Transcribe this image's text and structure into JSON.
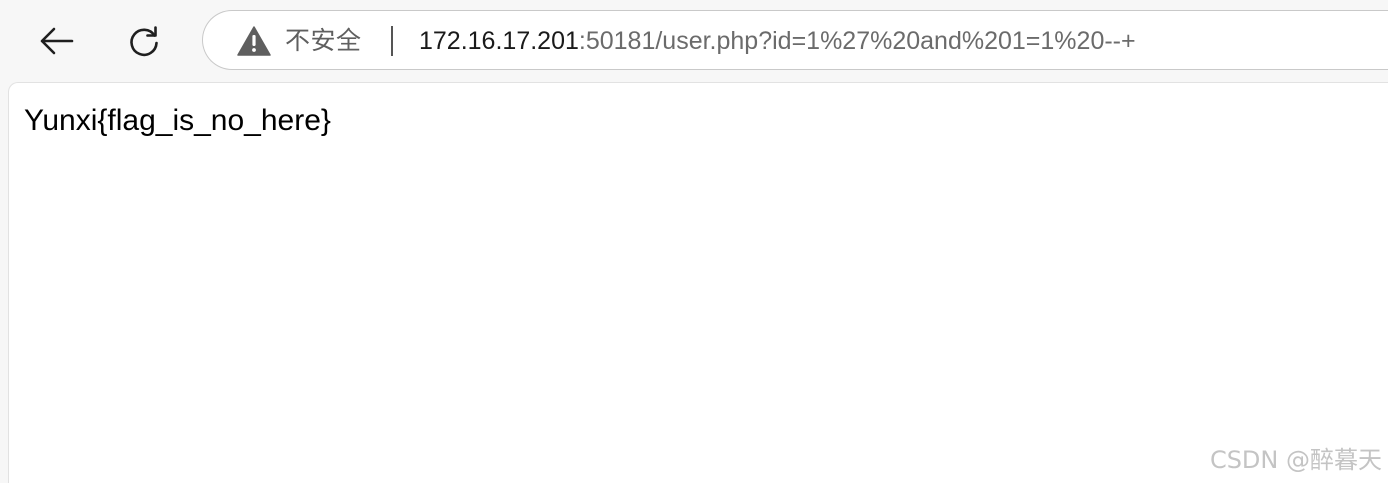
{
  "toolbar": {
    "back_icon": "arrow-left-icon",
    "reload_icon": "reload-icon",
    "security_icon": "warning-triangle-icon",
    "security_label": "不安全",
    "url_host": "172.16.17.201",
    "url_rest": ":50181/user.php?id=1%27%20and%201=1%20--+"
  },
  "page": {
    "text": "Yunxi{flag_is_no_here}"
  },
  "watermark": {
    "text": "CSDN @醉暮天"
  },
  "colors": {
    "toolbar_bg": "#f7f7f7",
    "warning_icon": "#5f5f5f",
    "url_host": "#1a1a1a",
    "url_rest": "#6b6b6b"
  }
}
